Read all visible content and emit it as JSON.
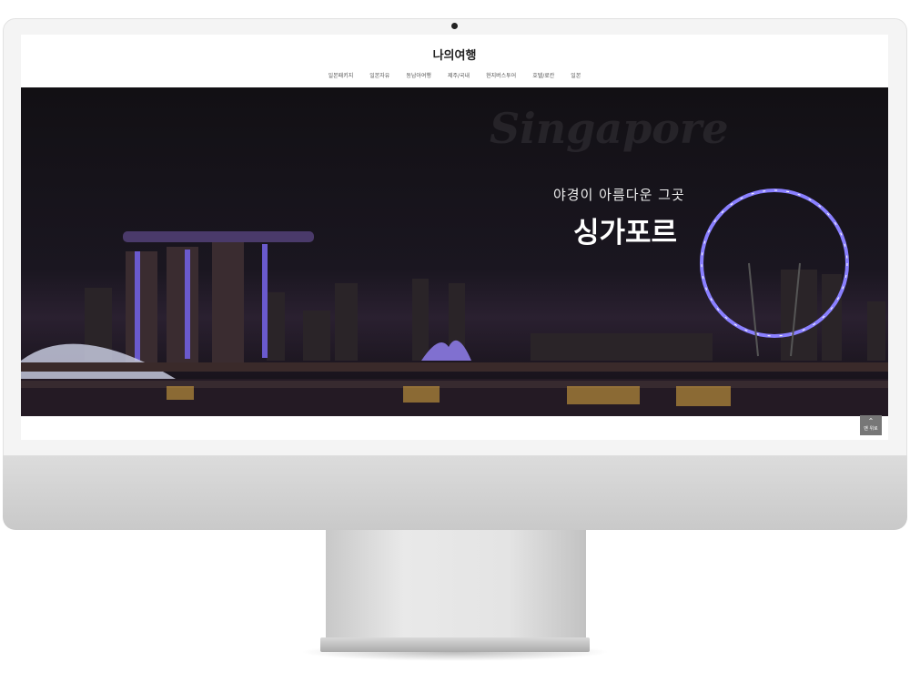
{
  "site": {
    "logo": "나의여행"
  },
  "nav": [
    "일본패키지",
    "일본자유",
    "동남아여행",
    "제주/국내",
    "현지버스투어",
    "호텔/료칸",
    "일본"
  ],
  "hero": {
    "script_text": "Singapore",
    "subtitle": "야경이 아름다운 그곳",
    "title": "싱가포르"
  },
  "top_button": {
    "label": "맨 위로"
  }
}
